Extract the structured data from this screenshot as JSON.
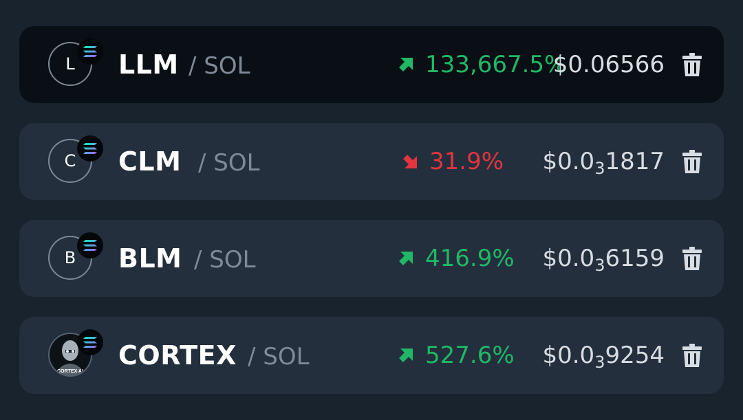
{
  "colors": {
    "up": "#20b866",
    "down": "#e3343f",
    "row_bg": "#232f3c",
    "active_row_bg": "#0a0f15",
    "page_bg": "#18232d"
  },
  "pairs": [
    {
      "avatar_letter": "L",
      "token": "LLM",
      "quote": "/ SOL",
      "change": "133,667.5%",
      "direction": "up",
      "price": "$0.06566"
    },
    {
      "avatar_letter": "C",
      "token": "CLM",
      "quote": "/ SOL",
      "change": "31.9%",
      "direction": "down",
      "price_prefix": "$0.0",
      "price_zeros": "3",
      "price_digits": "1817"
    },
    {
      "avatar_letter": "B",
      "token": "BLM",
      "quote": "/ SOL",
      "change": "416.9%",
      "direction": "up",
      "price_prefix": "$0.0",
      "price_zeros": "3",
      "price_digits": "6159"
    },
    {
      "avatar_image": "cortex-robot-logo",
      "avatar_caption": "CORTEX AI",
      "token": "CORTEX",
      "quote": "/ SOL",
      "change": "527.6%",
      "direction": "up",
      "price_prefix": "$0.0",
      "price_zeros": "3",
      "price_digits": "9254"
    }
  ],
  "icons": {
    "chain_badge": "solana-icon",
    "up": "arrow-up-right-icon",
    "down": "arrow-down-right-icon",
    "delete": "trash-icon"
  }
}
